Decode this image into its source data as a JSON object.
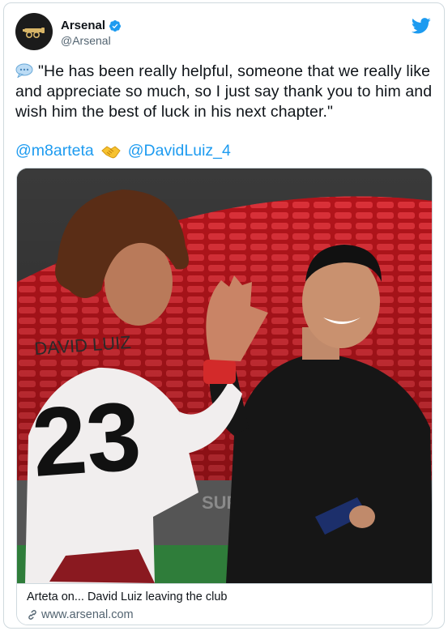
{
  "account": {
    "display_name": "Arsenal",
    "handle": "@Arsenal",
    "verified": true
  },
  "tweet": {
    "text": "\"He has been really helpful, someone that we really like and appreciate so much, so I just say thank you to him and wish him the best of luck in his next chapter.\"",
    "emoji_lead": "speech-balloon",
    "mention_1": "@m8arteta",
    "mention_2": "@DavidLuiz_4",
    "emoji_between": "handshake"
  },
  "card": {
    "title": "Arteta on... David Luiz leaving the club",
    "domain": "www.arsenal.com"
  },
  "photo": {
    "jersey_name": "DAVID LUIZ",
    "jersey_number": "23"
  },
  "colors": {
    "accent": "#1d9bf0",
    "text": "#0f1419",
    "muted": "#536471"
  }
}
